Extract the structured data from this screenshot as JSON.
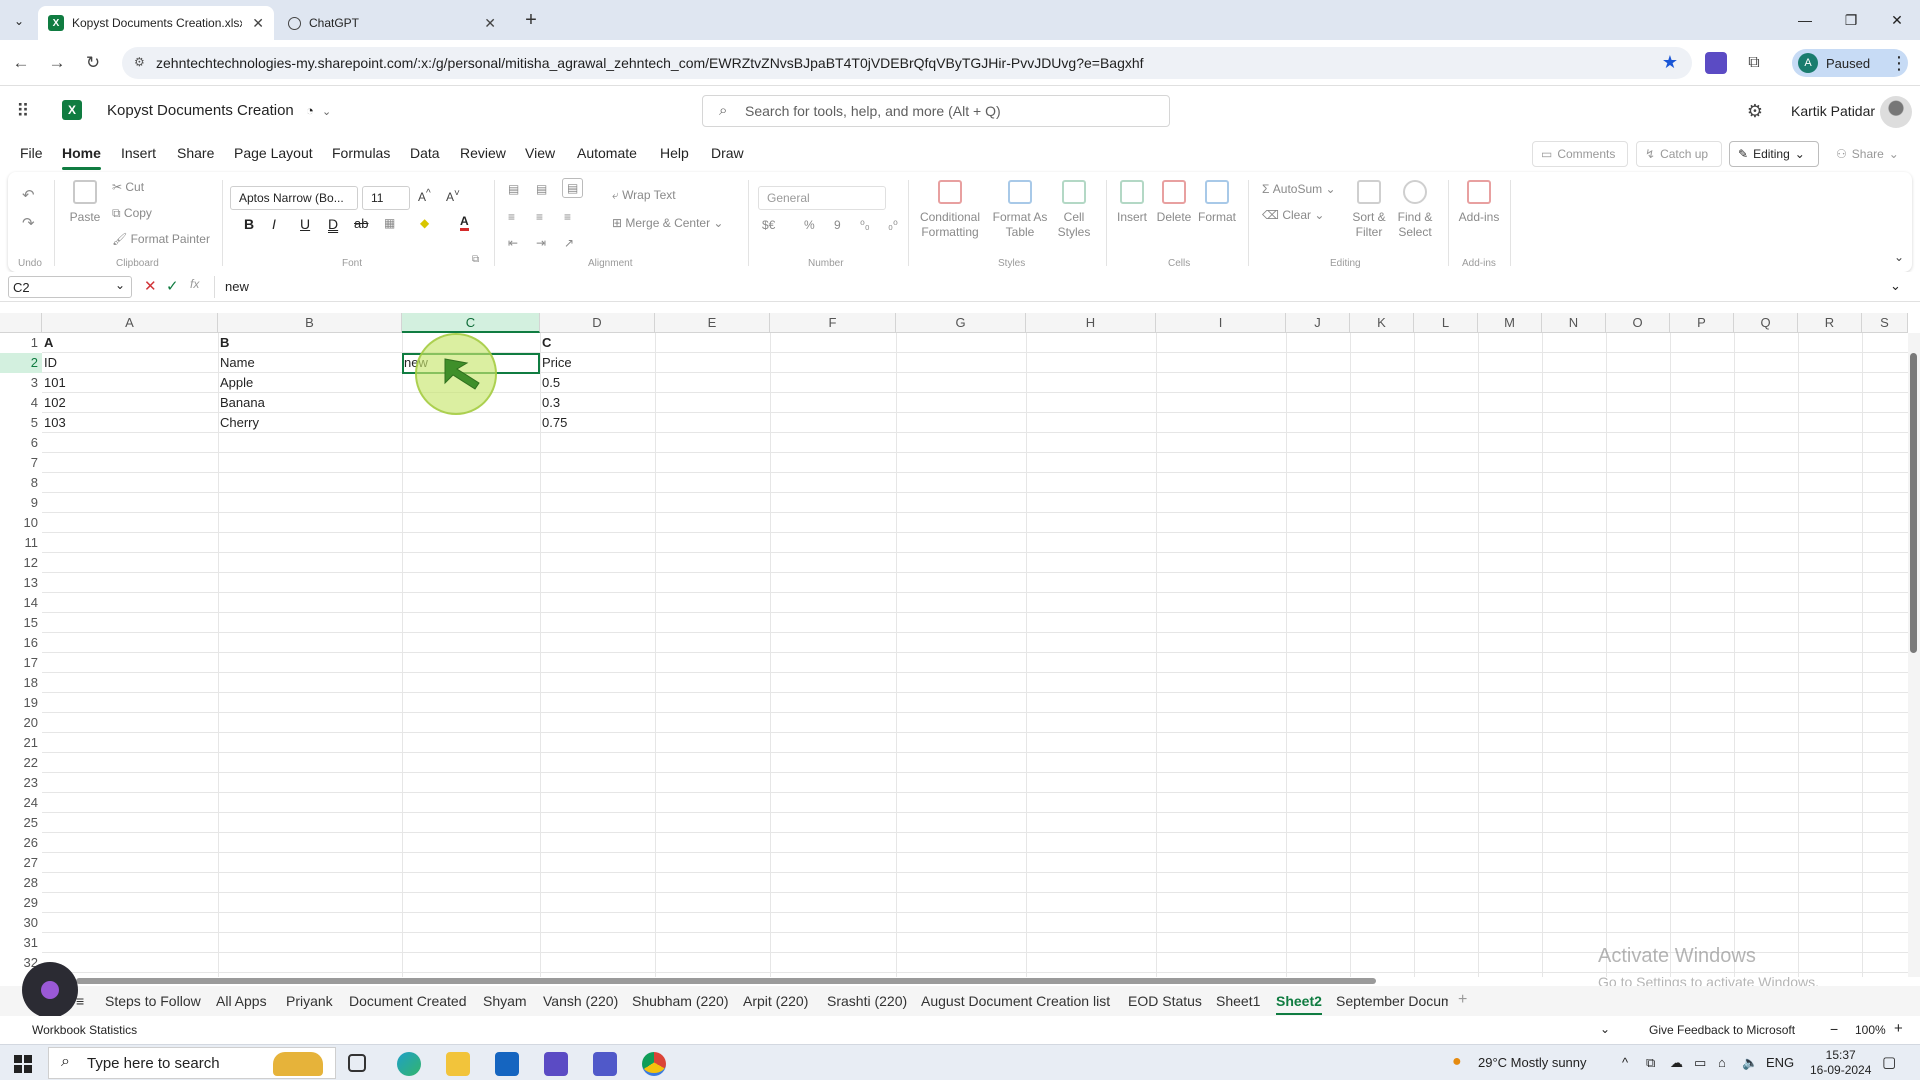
{
  "browser": {
    "tabs": [
      {
        "title": "Kopyst Documents Creation.xlsx",
        "active": true
      },
      {
        "title": "ChatGPT",
        "active": false
      }
    ],
    "new_tab": "+",
    "url": "zehntechtechnologies-my.sharepoint.com/:x:/g/personal/mitisha_agrawal_zehntech_com/EWRZtvZNvsBJpaBT4T0jVDEBrQfqVByTGJHir-PvvJDUvg?e=Bagxhf",
    "profile_initial": "A",
    "profile_status": "Paused"
  },
  "excel": {
    "doc_title": "Kopyst Documents Creation",
    "search_placeholder": "Search for tools, help, and more (Alt + Q)",
    "user_name": "Kartik Patidar",
    "menus": [
      "File",
      "Home",
      "Insert",
      "Share",
      "Page Layout",
      "Formulas",
      "Data",
      "Review",
      "View",
      "Automate",
      "Help",
      "Draw"
    ],
    "active_menu": "Home",
    "comments_label": "Comments",
    "catchup_label": "Catch up",
    "editing_label": "Editing",
    "share_label": "Share"
  },
  "ribbon": {
    "undo_group": "Undo",
    "clipboard": {
      "paste": "Paste",
      "cut": "Cut",
      "copy": "Copy",
      "format_painter": "Format Painter",
      "group": "Clipboard"
    },
    "font": {
      "name": "Aptos Narrow (Bo...",
      "size": "11",
      "group": "Font",
      "bold": "B",
      "italic": "I",
      "underline": "U",
      "double_underline": "D",
      "strike": "ab"
    },
    "alignment": {
      "wrap": "Wrap Text",
      "merge": "Merge & Center",
      "group": "Alignment"
    },
    "number": {
      "format": "General",
      "currency": "$€",
      "percent": "%",
      "comma": "9",
      "group": "Number"
    },
    "styles": {
      "conditional": "Conditional Formatting",
      "format_table": "Format As Table",
      "cell_styles": "Cell Styles",
      "group": "Styles"
    },
    "cells": {
      "insert": "Insert",
      "delete": "Delete",
      "format": "Format",
      "group": "Cells"
    },
    "editing": {
      "autosum": "AutoSum",
      "clear": "Clear",
      "sort": "Sort & Filter",
      "find": "Find & Select",
      "group": "Editing"
    },
    "addins": {
      "label": "Add-ins",
      "group": "Add-ins"
    }
  },
  "formula_bar": {
    "name_box": "C2",
    "content": "new"
  },
  "grid": {
    "columns": [
      "A",
      "B",
      "C",
      "D",
      "E",
      "F",
      "G",
      "H",
      "I",
      "J",
      "K",
      "L",
      "M",
      "N",
      "O",
      "P",
      "Q",
      "R",
      "S"
    ],
    "selected_column": "C",
    "selected_row": 2,
    "rows": [
      "1",
      "2",
      "3",
      "4",
      "5",
      "6",
      "7",
      "8",
      "9",
      "10",
      "11",
      "12",
      "13",
      "14",
      "15",
      "16",
      "17",
      "18",
      "19",
      "20",
      "21",
      "22",
      "23",
      "24",
      "25",
      "26",
      "27",
      "28",
      "29",
      "30",
      "31",
      "32"
    ],
    "cells": {
      "A1": "A",
      "B1": "B",
      "D1": "C",
      "A2": "ID",
      "B2": "Name",
      "C2": "new",
      "D2": "Price",
      "A3": "101",
      "B3": "Apple",
      "D3": "0.5",
      "A4": "102",
      "B4": "Banana",
      "D4": "0.3",
      "A5": "103",
      "B5": "Cherry",
      "D5": "0.75"
    }
  },
  "sheets": {
    "tabs": [
      "Steps to Follow",
      "All Apps",
      "Priyank",
      "Document Created",
      "Shyam",
      "Vansh (220)",
      "Shubham (220)",
      "Arpit (220)",
      "Srashti (220)",
      "August Document Creation list",
      "EOD Status",
      "Sheet1",
      "Sheet2",
      "September Docum"
    ],
    "active": "Sheet2",
    "add": "+"
  },
  "status": {
    "left": "Workbook Statistics",
    "feedback": "Give Feedback to Microsoft",
    "zoom": "100%",
    "zoom_minus": "−",
    "zoom_plus": "+"
  },
  "watermark": {
    "line1": "Activate Windows",
    "line2": "Go to Settings to activate Windows."
  },
  "taskbar": {
    "search_placeholder": "Type here to search",
    "weather": "29°C  Mostly sunny",
    "lang": "ENG",
    "time": "15:37",
    "date": "16-09-2024"
  },
  "colors": {
    "excel_green": "#107c41",
    "selection_fill": "#d3f0df",
    "chrome_tab_strip": "#dfe6f1"
  }
}
